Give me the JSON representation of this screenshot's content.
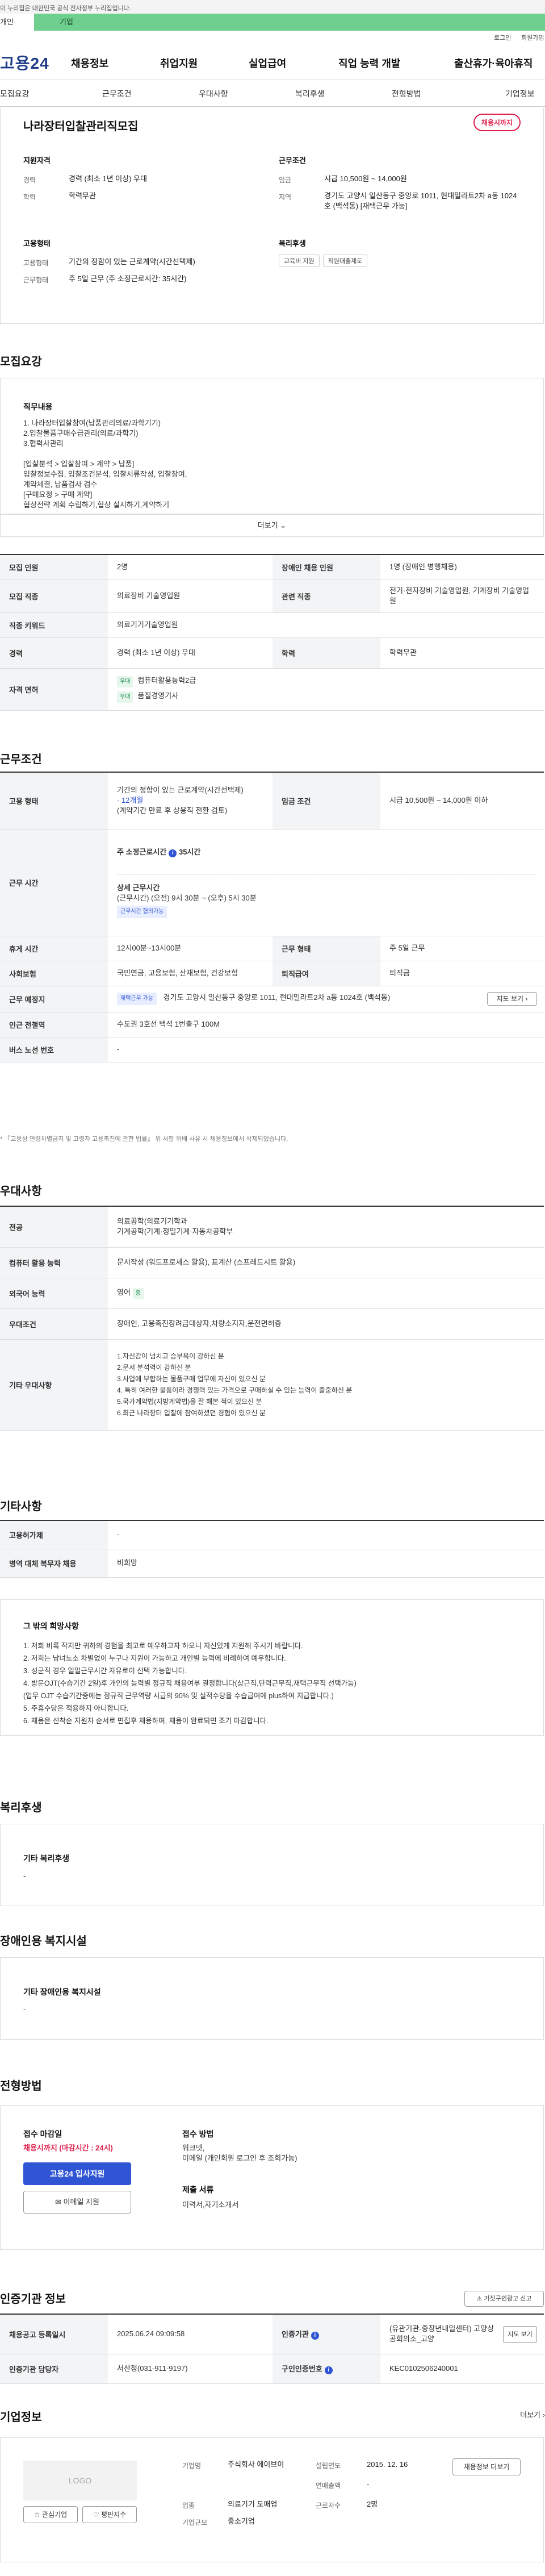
{
  "gov_notice": "이 누리집은 대한민국 공식 전자정부 누리집입니다.",
  "persona": {
    "personal": "개인",
    "corporate": "기업"
  },
  "util": {
    "login": "로그인",
    "join": "회원가입"
  },
  "header": {
    "logo": "고용24",
    "gnb": [
      "채용정보",
      "취업지원",
      "실업급여",
      "직업 능력 개발",
      "출산휴가·육아휴직"
    ]
  },
  "subnav": [
    "모집요강",
    "근무조건",
    "우대사항",
    "복리후생",
    "전형방법",
    "기업정보"
  ],
  "summary": {
    "title": "나라장터입찰관리직모집",
    "status_badge": "채용시까지",
    "applicant_title": "지원자격",
    "career_label": "경력",
    "career_value": "경력 (최소 1년 이상) 우대",
    "edu_label": "학력",
    "edu_value": "학력무관",
    "work_title": "근무조건",
    "wage_label": "임금",
    "wage_value": "시급 10,500원 ~ 14,000원",
    "region_label": "지역",
    "region_value": "경기도 고양시 일산동구 중앙로 1011, 현대밀라트2차 a동 1024호 (백석동) [재택근무 가능]",
    "emp_title": "고용형태",
    "emp_type_label": "고용형태",
    "emp_type_value": "기간의 정함이 있는 근로계약(시간선택제)",
    "work_type_label": "근무형태",
    "work_type_value": "주 5일 근무 (주 소정근로시간: 35시간)",
    "welfare_title": "복리후생",
    "welfare_tags": [
      "교육비 지원",
      "직원대출제도"
    ]
  },
  "recruit": {
    "section_title": "모집요강",
    "duty_title": "직무내용",
    "duty_text": "1. 나라장터입찰참여(납품관리의료/과학기기)\n2.입찰물품구매수급관리(의료/과학기)\n3.협력사관리\n\n[입찰분석 > 입찰참여 > 계약 > 납품]\n입찰정보수집, 입찰조건분석, 입찰서류작성, 입찰참여,\n계약체결, 납품검사 검수\n[구매요청 > 구매 계약]\n협상전략 계획 수립하기,협상 실시하기,계약하기",
    "more": "더보기",
    "rows": {
      "count_label": "모집 인원",
      "count_value": "2명",
      "disabled_label": "장애인 채용 인원",
      "disabled_value": "1명 (장애인 병행채용)",
      "job_label": "모집 직종",
      "job_value": "의료장비 기술영업원",
      "rel_label": "관련 직종",
      "rel_value": "전기·전자장비 기술영업원, 기계장비 기술영업원",
      "kw_label": "직종 키워드",
      "kw_value": "의료기기기술영업원",
      "career_label": "경력",
      "career_value": "경력 (최소 1년 이상) 우대",
      "edu_label": "학력",
      "edu_value": "학력무관",
      "license_label": "자격 면허",
      "licenses": [
        {
          "badge": "우대",
          "name": "컴퓨터활용능력2급"
        },
        {
          "badge": "우대",
          "name": "품질경영기사"
        }
      ]
    }
  },
  "work": {
    "section_title": "근무조건",
    "emp_label": "고용 형태",
    "emp_line1": "기간의 정함이 있는 근로계약(시간선택제)",
    "emp_line2": "· 12개월",
    "emp_line3": "(계약기간 만료 후 상용직 전환 검토)",
    "wage_label": "임금 조건",
    "wage_value": "시급 10,500원 ~ 14,000원 이하",
    "hours_label": "근무 시간",
    "hours_week": "주 소정근로시간",
    "hours_week_value": "35시간",
    "hours_detail_title": "상세 근무시간",
    "hours_detail": "(근무시간) (오전) 9시 30분 ~ (오후) 5시 30분",
    "hours_badge": "근무시간 협의가능",
    "rest_label": "휴게 시간",
    "rest_value": "12시00분~13시00분",
    "type_label": "근무 형태",
    "type_value": "주 5일 근무",
    "ins_label": "사회보험",
    "ins_value": "국민연금, 고용보험, 산재보험, 건강보험",
    "ret_label": "퇴직급여",
    "ret_value": "퇴직금",
    "place_label": "근무 예정지",
    "place_badge": "재택근무 가능",
    "place_value": "경기도 고양시 일산동구 중앙로 1011, 현대밀라트2차 a동 1024호 (백석동)",
    "map_button": "지도 보기",
    "subway_label": "인근 전철역",
    "subway_value": "수도권 3호선 백석 1번출구 100M",
    "bus_label": "버스 노선 번호",
    "bus_value": "-",
    "note": "* 『고용상 연령차별금지 및 고령자 고용촉진에 관한 법률』 위 사항 위배 사유 시 채용정보에서 삭제되었습니다."
  },
  "pref": {
    "section_title": "우대사항",
    "major_label": "전공",
    "major_value": "의료공학(의료기기학과\n기계공학(기계·정밀기계·자동차공학부",
    "pc_label": "컴퓨터 활용 능력",
    "pc_value": "문서작성 (워드프로세스 활용), 표계산 (스프레드시트 활용)",
    "lang_label": "외국어 능력",
    "lang_value": "영어",
    "lang_badge": "중",
    "target_label": "우대조건",
    "target_value": "장애인, 고용촉진장려금대상자,차량소지자,운전면허증",
    "etc_label": "기타 우대사항",
    "etc_value": "1.자신감이 넘치고 승부욕이 강하신 분\n2.문서 분석력이 강하신 분\n3.사업에 부합하는 물품구매 업무에 자신이 있으신 분\n4. 특히 여러한 물품이라 경쟁력 있는 가격으로 구매하실 수 있는 능력이 출중하신 분\n5.국가계약법(지방계약법)을 잘 해본 적이 있으신 분\n6.최근 나라장터 입찰에 참여하셨던 경험이 있으신 분"
  },
  "etc": {
    "section_title": "기타사항",
    "mobile_label": "고용허가제",
    "mobile_value": "-",
    "army_label": "병역 대체 복무자 채용",
    "army_value": "비희망",
    "other_title": "그 밖의 희망사항",
    "other_text": "1. 저희 비록 작지만 귀하의 경험을 최고로 예우하고자 하오니 지신있게 지원해 주시기 바랍니다.\n2. 저희는 남녀노소 차별없이 누구나 지원이 가능하고 개인별 능력에 비례하여 예우합니다.\n3. 성군직 경우 일일근무시간 자유로이 선택 가능합니다.\n4. 방문OJT(수습기간 2일)후 개인의 능력별 정규직 채용여부 결정합니다(상근직,탄력근무직,재택근무직 선택가능)\n   (업무 OJT 수습기간중에는 정규직 근무역량 시급의 90% 및 실적수당을 수습급여에 plus하여 지급합니다.)\n5. 주휴수당은 적용하지 아니합니다.\n6. 채용은 선착순 지원자 순서로 면접후 채용하며, 채용이 완료되면 조기 마감합니다."
  },
  "welfare": {
    "section_title": "복리후생",
    "inner_title": "기타 복리후생",
    "inner_value": "-"
  },
  "disability": {
    "section_title": "장애인용 복지시설",
    "inner_title": "기타 장애인용 복지시설",
    "inner_value": "-"
  },
  "apply": {
    "section_title": "전형방법",
    "deadline_title": "접수 마감일",
    "deadline_value": "채용시까지 (마감시간 : 24시)",
    "apply_button": "고용24 입사지원",
    "email_button": "이메일 지원",
    "method_title": "접수 방법",
    "method_value": "워크넷,\n이메일 (개인회원 로그인 후 조회가능)",
    "docs_title": "제출 서류",
    "docs_value": "이력서,자기소개서"
  },
  "agency": {
    "section_title": "인증기관 정보",
    "report_button": "거짓구인광고 신고",
    "reg_label": "채용공고 등록일시",
    "reg_value": "2025.06.24 09:09:58",
    "org_label": "인증기관",
    "org_value": "(유관기관-중장년내일센터) 고양상공회의소_고양",
    "org_more": "지도 보기",
    "contact_label": "인증기관 담당자",
    "contact_value": "서산청(031-911-9197)",
    "id_label": "구인인증번호",
    "id_value": "KEC0102506240001"
  },
  "company": {
    "section_title": "기업정보",
    "more": "더보기",
    "logo_text": "LOGO",
    "interest_button": "관심기업",
    "heart_button": "평판지수",
    "name_label": "기업명",
    "name_value": "주식회사 에이브이",
    "est_label": "설립연도",
    "est_value": "2015. 12. 16",
    "sales_label": "연매출액",
    "sales_value": "-",
    "industry_label": "업종",
    "industry_value": "의료기기 도매업",
    "staff_label": "근로자수",
    "staff_value": "2명",
    "size_label": "기업규모",
    "size_value": "중소기업",
    "info_button": "채용정보 더보기"
  }
}
